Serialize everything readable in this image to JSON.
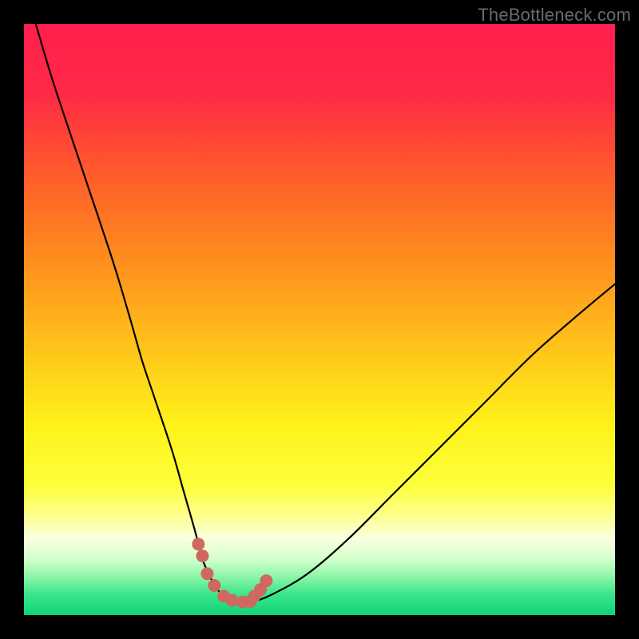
{
  "watermark": "TheBottleneck.com",
  "gradient_stops": [
    {
      "offset": 0.0,
      "color": "#ff1f4e"
    },
    {
      "offset": 0.12,
      "color": "#ff2a45"
    },
    {
      "offset": 0.25,
      "color": "#ff5a2c"
    },
    {
      "offset": 0.4,
      "color": "#ff8e1e"
    },
    {
      "offset": 0.55,
      "color": "#ffc41a"
    },
    {
      "offset": 0.68,
      "color": "#fff21a"
    },
    {
      "offset": 0.78,
      "color": "#fdff3a"
    },
    {
      "offset": 0.83,
      "color": "#fdff8a"
    },
    {
      "offset": 0.87,
      "color": "#faffe0"
    },
    {
      "offset": 0.905,
      "color": "#d4ffcc"
    },
    {
      "offset": 0.935,
      "color": "#8cf5a8"
    },
    {
      "offset": 0.965,
      "color": "#3ae58c"
    },
    {
      "offset": 1.0,
      "color": "#0fd575"
    }
  ],
  "curve_color": "#000000",
  "curve_width": 2.2,
  "marker_color": "#cf695f",
  "marker_radius": 8,
  "chart_data": {
    "type": "line",
    "title": "",
    "xlabel": "",
    "ylabel": "",
    "xlim": [
      0,
      100
    ],
    "ylim": [
      0,
      100
    ],
    "series": [
      {
        "name": "bottleneck-curve",
        "x": [
          2,
          5,
          10,
          15,
          18,
          20,
          22,
          25,
          27,
          29,
          30,
          31,
          32,
          33,
          34,
          35,
          36.5,
          38,
          42,
          48,
          55,
          62,
          70,
          78,
          86,
          94,
          100
        ],
        "y": [
          100,
          90,
          75,
          60,
          50,
          43,
          37,
          28,
          21,
          14,
          10,
          7.5,
          5.5,
          4,
          3,
          2.5,
          2,
          2,
          3.5,
          7,
          13,
          20,
          28,
          36,
          44,
          51,
          56
        ]
      }
    ],
    "markers": {
      "name": "highlight-points",
      "x": [
        29.5,
        30.2,
        31,
        32.2,
        33.8,
        35.2,
        37,
        38.3,
        39,
        40,
        41
      ],
      "y": [
        12,
        10,
        7,
        5,
        3.2,
        2.5,
        2.2,
        2.3,
        3.2,
        4.3,
        5.8
      ]
    }
  }
}
